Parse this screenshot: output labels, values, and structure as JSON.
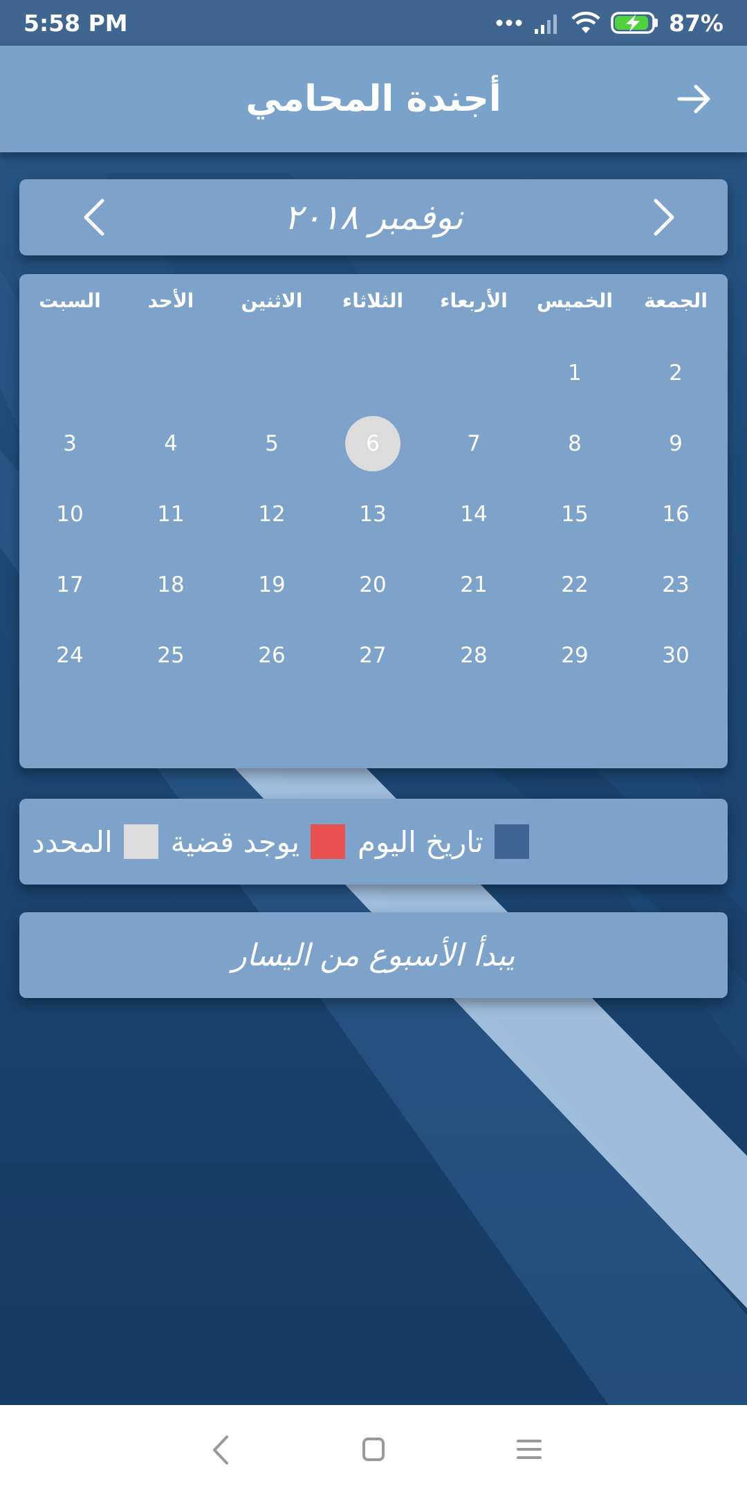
{
  "status_bar": {
    "time": "5:58 PM",
    "battery": "87%"
  },
  "app_bar": {
    "title": "أجندة المحامي"
  },
  "month_nav": {
    "label": "نوفمبر ٢٠١٨"
  },
  "calendar": {
    "weekdays": [
      "الجمعة",
      "الخميس",
      "الأربعاء",
      "الثلاثاء",
      "الاثنين",
      "الأحد",
      "السبت"
    ],
    "weeks": [
      [
        "2",
        "1",
        "",
        "",
        "",
        "",
        ""
      ],
      [
        "9",
        "8",
        "7",
        "6",
        "5",
        "4",
        "3"
      ],
      [
        "16",
        "15",
        "14",
        "13",
        "12",
        "11",
        "10"
      ],
      [
        "23",
        "22",
        "21",
        "20",
        "19",
        "18",
        "17"
      ],
      [
        "30",
        "29",
        "28",
        "27",
        "26",
        "25",
        "24"
      ]
    ],
    "today": "6"
  },
  "legend": {
    "items": [
      {
        "label": "تاريخ اليوم",
        "color": "#3d6593"
      },
      {
        "label": "يوجد قضية",
        "color": "#e8514f"
      },
      {
        "label": "المحدد",
        "color": "#dcdcdc"
      }
    ]
  },
  "note": {
    "text": "يبدأ الأسبوع من اليسار"
  }
}
